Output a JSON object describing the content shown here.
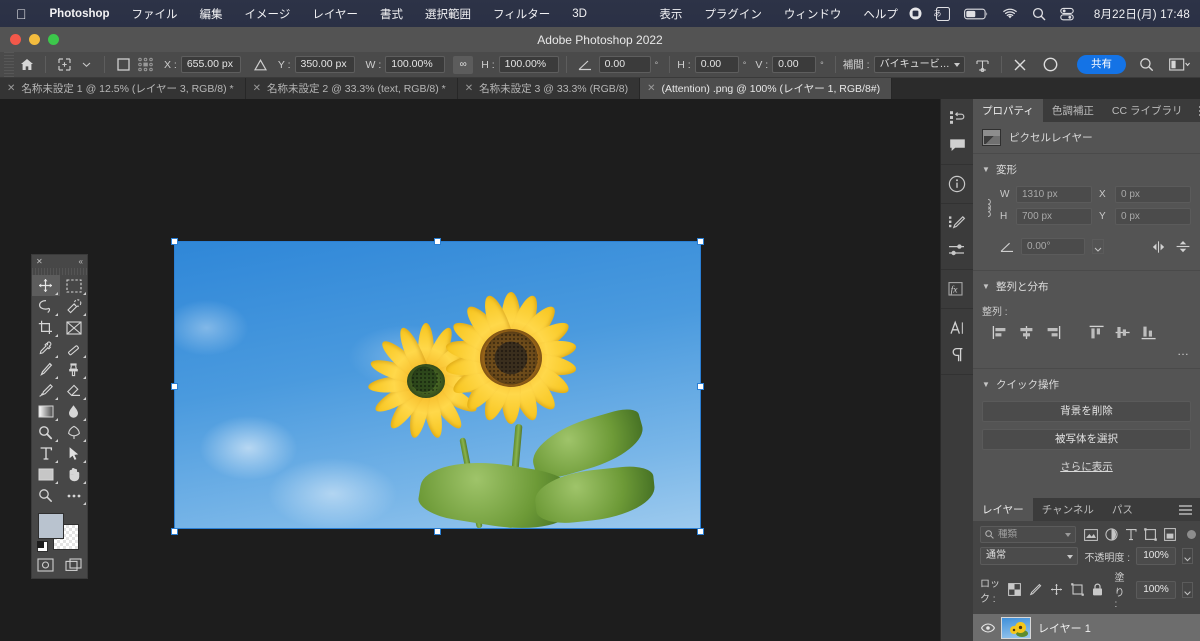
{
  "macbar": {
    "apple": "apple-logo",
    "items": [
      {
        "label": "Photoshop",
        "bold": true
      },
      {
        "label": "ファイル",
        "bold": false
      },
      {
        "label": "編集",
        "bold": false
      },
      {
        "label": "イメージ",
        "bold": false
      },
      {
        "label": "レイヤー",
        "bold": false
      },
      {
        "label": "書式",
        "bold": false
      },
      {
        "label": "選択範囲",
        "bold": false
      },
      {
        "label": "フィルター",
        "bold": false
      },
      {
        "label": "3D",
        "bold": false
      },
      {
        "label": "表示",
        "bold": false
      },
      {
        "label": "プラグイン",
        "bold": false
      },
      {
        "label": "ウィンドウ",
        "bold": false
      },
      {
        "label": "ヘルプ",
        "bold": false
      }
    ],
    "status_icons": [
      "record-icon",
      "ime-japanese-icon",
      "battery-icon",
      "wifi-icon",
      "search-icon",
      "control-center-icon"
    ],
    "ime_label": "あ",
    "clock": "8月22日(月)  17:48"
  },
  "window": {
    "title": "Adobe Photoshop 2022",
    "traffic_lights": [
      "close-button",
      "minimize-button",
      "zoom-button"
    ]
  },
  "options_bar": {
    "home_icon": "home-icon",
    "tool_icon": "move-tool-icon",
    "tool_chevron": "chevron-down-icon",
    "auto_select_checkbox": "auto-select-checkbox",
    "transform_controls_icon": "transform-controls-icon",
    "x_label": "X :",
    "x_value": "655.00 px",
    "delta_icon": "delta-icon",
    "y_label": "Y :",
    "y_value": "350.00 px",
    "w_label": "W :",
    "w_value": "100.00%",
    "link_icon": "link-icon",
    "h_label": "H :",
    "h_value": "100.00%",
    "angle_icon": "angle-icon",
    "angle_value": "0.00",
    "degree": "°",
    "skew_h_label": "H :",
    "skew_h_value": "0.00",
    "skew_v_label": "V :",
    "skew_v_value": "0.00",
    "interp_label": "補間 :",
    "interp_value": "バイキュービ…",
    "warp_icon": "warp-icon",
    "cancel_icon": "cancel-transform-icon",
    "commit_icon": "commit-transform-icon",
    "share_label": "共有",
    "search_icon": "search-icon",
    "workspace_icon": "workspace-switcher-icon"
  },
  "tabs": [
    {
      "title": "名称未設定 1 @ 12.5% (レイヤー 3, RGB/8) *",
      "active": false
    },
    {
      "title": "名称未設定 2 @ 33.3% (text, RGB/8) *",
      "active": false
    },
    {
      "title": "名称未設定 3 @ 33.3% (RGB/8)",
      "active": false
    },
    {
      "title": "(Attention) .png @ 100% (レイヤー 1, RGB/8#)",
      "active": true
    }
  ],
  "toolbar": {
    "close_icon": "close-icon",
    "collapse_icon": "collapse-panel-icon",
    "tools": [
      {
        "name": "move-tool",
        "selected": true
      },
      {
        "name": "rectangular-marquee-tool",
        "selected": false
      },
      {
        "name": "lasso-tool",
        "selected": false
      },
      {
        "name": "quick-selection-tool",
        "selected": false
      },
      {
        "name": "crop-tool",
        "selected": false
      },
      {
        "name": "frame-tool",
        "selected": false
      },
      {
        "name": "eyedropper-tool",
        "selected": false
      },
      {
        "name": "spot-healing-brush-tool",
        "selected": false
      },
      {
        "name": "brush-tool",
        "selected": false
      },
      {
        "name": "clone-stamp-tool",
        "selected": false
      },
      {
        "name": "history-brush-tool",
        "selected": false
      },
      {
        "name": "eraser-tool",
        "selected": false
      },
      {
        "name": "gradient-tool",
        "selected": false
      },
      {
        "name": "blur-tool",
        "selected": false
      },
      {
        "name": "dodge-tool",
        "selected": false
      },
      {
        "name": "pen-tool",
        "selected": false
      },
      {
        "name": "horizontal-type-tool",
        "selected": false
      },
      {
        "name": "path-selection-tool",
        "selected": false
      },
      {
        "name": "rectangle-tool",
        "selected": false
      },
      {
        "name": "hand-tool",
        "selected": false
      },
      {
        "name": "zoom-tool",
        "selected": false
      },
      {
        "name": "edit-toolbar-tool",
        "selected": false
      }
    ],
    "foreground_color": "#b9c3cf",
    "background_color": "#ffffff",
    "quick_mask_icon": "quick-mask-icon",
    "screen_mode_icon": "screen-mode-icon"
  },
  "icon_dock": [
    "history-icon",
    "comments-icon",
    "info-icon",
    "brush-settings-icon",
    "adjustments-icon",
    "layer-styles-fx-icon",
    "character-panel-icon",
    "paragraph-panel-icon"
  ],
  "properties": {
    "tabs": [
      {
        "label": "プロパティ",
        "active": true
      },
      {
        "label": "色調補正",
        "active": false
      },
      {
        "label": "CC ライブラリ",
        "active": false
      }
    ],
    "menu_icon": "panel-menu-icon",
    "layer_kind": "ピクセルレイヤー",
    "layer_kind_icon": "pixel-layer-icon",
    "transform": {
      "title": "変形",
      "w_label": "W",
      "w_value": "1310 px",
      "x_label": "X",
      "x_value": "0 px",
      "h_label": "H",
      "h_value": "700 px",
      "y_label": "Y",
      "y_value": "0 px",
      "link_icon": "constrain-proportions-icon",
      "angle_icon": "angle-icon",
      "angle_value": "0.00°",
      "flip_h_icon": "flip-horizontal-icon",
      "flip_v_icon": "flip-vertical-icon"
    },
    "align": {
      "title": "整列と分布",
      "label": "整列 :",
      "icons": [
        "align-left-icon",
        "align-center-horizontal-icon",
        "align-right-icon",
        "align-top-icon",
        "align-middle-vertical-icon",
        "align-bottom-icon"
      ],
      "more": "…"
    },
    "quick_actions": {
      "title": "クイック操作",
      "remove_background": "背景を削除",
      "select_subject": "被写体を選択",
      "more_link": "さらに表示"
    }
  },
  "layers": {
    "tabs": [
      {
        "label": "レイヤー",
        "active": true
      },
      {
        "label": "チャンネル",
        "active": false
      },
      {
        "label": "パス",
        "active": false
      }
    ],
    "menu_icon": "panel-menu-icon",
    "filter_placeholder": "種類",
    "filter_icons": [
      "filter-pixel-icon",
      "filter-adjustment-icon",
      "filter-type-icon",
      "filter-shape-icon",
      "filter-smart-object-icon"
    ],
    "filter_toggle": "filter-toggle-icon",
    "blend_mode": "通常",
    "opacity_label": "不透明度 :",
    "opacity_value": "100%",
    "lock_label": "ロック :",
    "lock_icons": [
      "lock-transparent-pixels-icon",
      "lock-image-pixels-icon",
      "lock-position-icon",
      "lock-artboard-icon",
      "lock-all-icon"
    ],
    "fill_label": "塗り :",
    "fill_value": "100%",
    "rows": [
      {
        "name": "レイヤー 1",
        "visible_icon": "eye-icon",
        "selected": true,
        "thumbnail": "sunflower-thumbnail"
      }
    ]
  },
  "canvas": {
    "document_name": "(Attention) .png",
    "zoom": "100%",
    "image_alt": "sunflower-photo",
    "transform_box": "transform-bounding-box",
    "handles": [
      "handle-tl",
      "handle-tc",
      "handle-tr",
      "handle-ml",
      "handle-mr",
      "handle-bl",
      "handle-bc",
      "handle-br"
    ],
    "accent_color": "#2a7fd4"
  }
}
